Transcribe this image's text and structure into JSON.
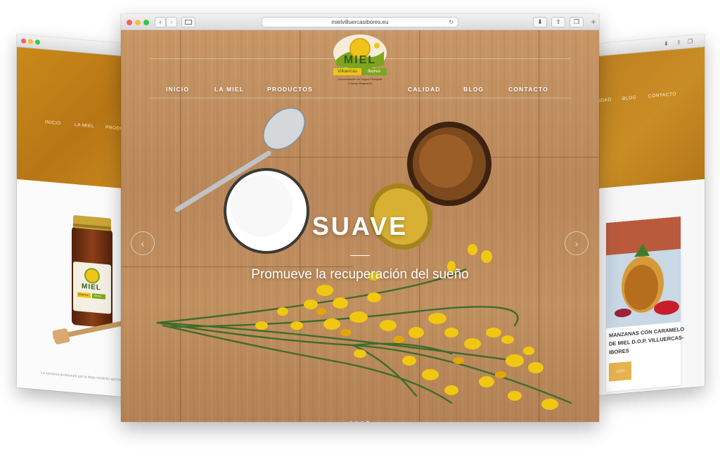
{
  "main_window": {
    "url": "mielvilluercasibores.eu",
    "toolbar": {
      "back": "‹",
      "forward": "›",
      "reload": "↻",
      "download": "⬇",
      "share": "⇪",
      "tabs": "❐",
      "new_tab": "+"
    }
  },
  "site": {
    "nav": [
      "INICIO",
      "LA MIEL",
      "PRODUCTOS",
      "CALIDAD",
      "BLOG",
      "CONTACTO"
    ],
    "logo": {
      "title": "MIEL",
      "name_left": "Villuercas",
      "name_right": "Ibores",
      "tagline_1": "Denominación de Origen Protegida",
      "tagline_2": "Consejo Regulador"
    },
    "slide": {
      "title": "SUAVE",
      "subtitle": "Promueve la recuperación del sueño",
      "prev": "‹",
      "next": "›",
      "pages": 4,
      "active_page": 4
    }
  },
  "left_window": {
    "nav": [
      "INICIO",
      "LA MIEL",
      "PRODU"
    ],
    "jar_label": "MIEL",
    "jar_sublabel_left": "Villuercas",
    "jar_sublabel_right": "Ibores",
    "footer_text": "La comarca productora por la larga tradición apícola"
  },
  "right_window": {
    "nav": [
      "IDAD",
      "BLOG",
      "CONTACTO"
    ],
    "card_title_1": "MANZANAS CON CARAMELO",
    "card_title_2": "DE MIEL D.O.P. VILLUERCAS-",
    "card_title_3": "IBORES",
    "card_button": "LEER"
  },
  "colors": {
    "accent": "#d9a53a",
    "honey": "#c98a1a",
    "logo_yellow": "#f0c419",
    "logo_green": "#7ea51f"
  }
}
